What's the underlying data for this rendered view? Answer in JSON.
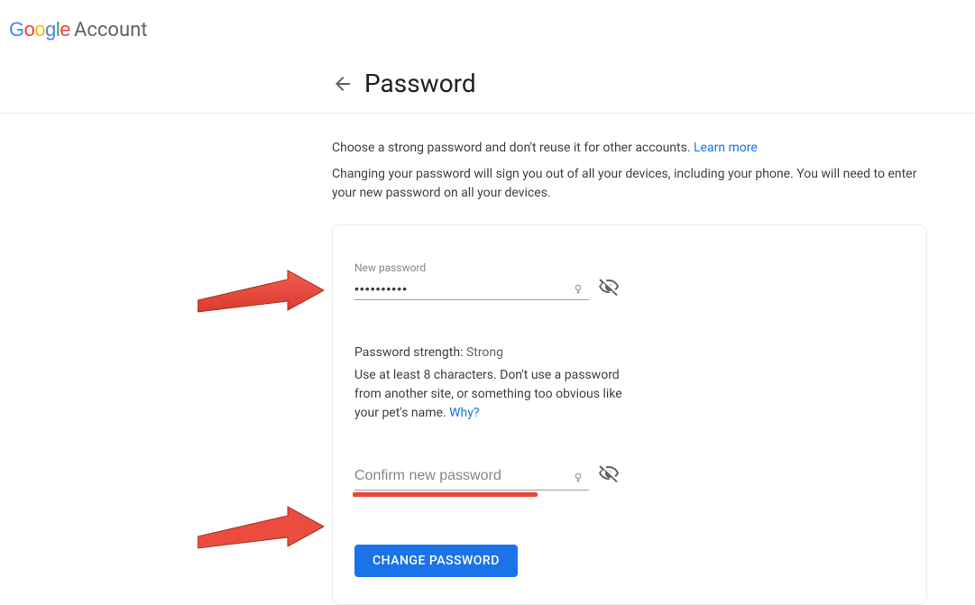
{
  "header": {
    "logo_parts": [
      "G",
      "o",
      "o",
      "g",
      "l",
      "e"
    ],
    "product": "Account"
  },
  "page": {
    "title": "Password"
  },
  "intro": {
    "line1_a": "Choose a strong password and don't reuse it for other accounts. ",
    "learn_more": "Learn more",
    "line2": "Changing your password will sign you out of all your devices, including your phone. You will need to enter your new password on all your devices."
  },
  "form": {
    "new_password": {
      "label": "New password",
      "value": "••••••••••"
    },
    "strength": {
      "label": "Password strength:",
      "value": "Strong",
      "hint_a": "Use at least 8 characters. Don't use a password from another site, or something too obvious like your pet's name. ",
      "why": "Why?"
    },
    "confirm": {
      "placeholder": "Confirm new password",
      "value": ""
    },
    "submit_label": "CHANGE PASSWORD"
  }
}
